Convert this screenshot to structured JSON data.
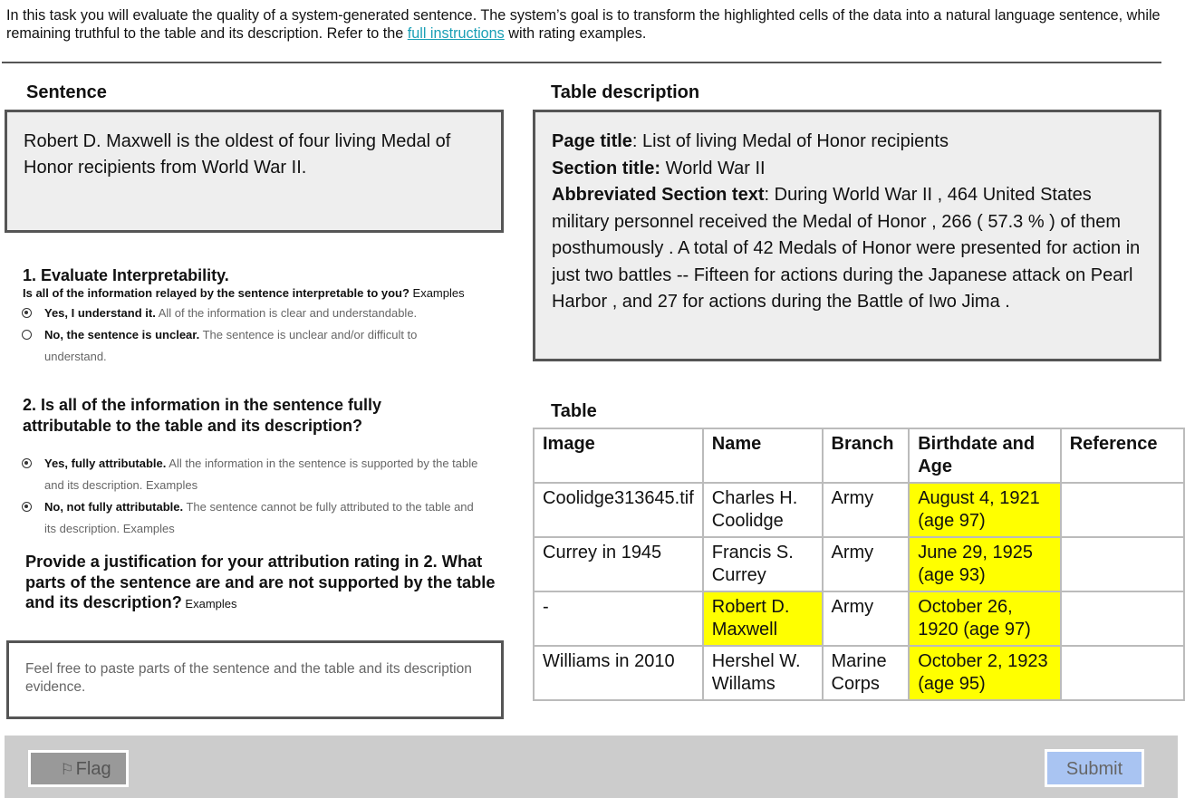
{
  "intro": {
    "text": "In this task you will evaluate the quality of a system-generated sentence. The system’s goal is to transform the highlighted cells of the data into a natural language sentence, while remaining truthful to the table and its description. Refer to the ",
    "link_text": "full instructions",
    "text_after": " with rating examples."
  },
  "sentence": {
    "heading": "Sentence",
    "text": "Robert D. Maxwell is the oldest of four living Medal of Honor recipients from World War II."
  },
  "description": {
    "heading": "Table description",
    "page_title_label": "Page title",
    "page_title": ": List of living Medal of Honor recipients",
    "section_title_label": "Section title:",
    "section_title": " World War II",
    "section_text_label": "Abbreviated Section text",
    "section_text": ": During World War II , 464 United States military personnel received the Medal of Honor , 266 ( 57.3 % ) of them posthumously . A total of 42 Medals of Honor were presented for action in just two battles -- Fifteen for actions during the Japanese attack on Pearl Harbor , and 27 for actions during the Battle of Iwo Jima ."
  },
  "q1": {
    "title": "1. Evaluate Interpretability.",
    "subtitle": "Is all of the information relayed by the sentence interpretable to you?",
    "examples": " Examples",
    "options": [
      {
        "label": "Yes, I understand it.",
        "desc": " All of the information is clear and understandable.",
        "checked": true
      },
      {
        "label": "No, the sentence is unclear.",
        "desc": " The sentence is unclear and/or difficult to understand.",
        "checked": false
      }
    ]
  },
  "q2": {
    "title": "2. Is all of the information in the sentence fully attributable to the table and its description?",
    "options": [
      {
        "label": "Yes, fully attributable.",
        "desc": "  All the information in the sentence is supported by the table and its description. Examples",
        "checked": true
      },
      {
        "label": "No, not fully attributable.",
        "desc": " The sentence cannot be fully attributed to the table and its description. Examples",
        "checked": true
      }
    ]
  },
  "justification": {
    "title": "Provide a justification for your attribution rating in 2. What parts of the sentence are and are not supported by the table and its description?",
    "examples": " Examples",
    "placeholder": "Feel free to paste parts of the sentence and the table and its description evidence."
  },
  "table": {
    "heading": "Table",
    "columns": [
      "Image",
      "Name",
      "Branch",
      "Birthdate and Age",
      "Reference"
    ],
    "rows": [
      {
        "cells": [
          "Coolidge313645.tif",
          "Charles H. Coolidge",
          "Army",
          "August 4, 1921 (age 97)",
          ""
        ],
        "highlight": [
          false,
          false,
          false,
          true,
          false
        ]
      },
      {
        "cells": [
          "Currey in 1945",
          "Francis S. Currey",
          "Army",
          "June 29, 1925 (age 93)",
          ""
        ],
        "highlight": [
          false,
          false,
          false,
          true,
          false
        ]
      },
      {
        "cells": [
          "-",
          "Robert D. Maxwell",
          "Army",
          "October 26, 1920 (age 97)",
          ""
        ],
        "highlight": [
          false,
          true,
          false,
          true,
          false
        ]
      },
      {
        "cells": [
          "Williams in 2010",
          "Hershel W. Willams",
          "Marine Corps",
          "October 2, 1923 (age 95)",
          ""
        ],
        "highlight": [
          false,
          false,
          false,
          true,
          false
        ]
      }
    ],
    "highlight_color": "#ffff00"
  },
  "footer": {
    "flag_label": "Flag",
    "submit_label": "Submit"
  }
}
